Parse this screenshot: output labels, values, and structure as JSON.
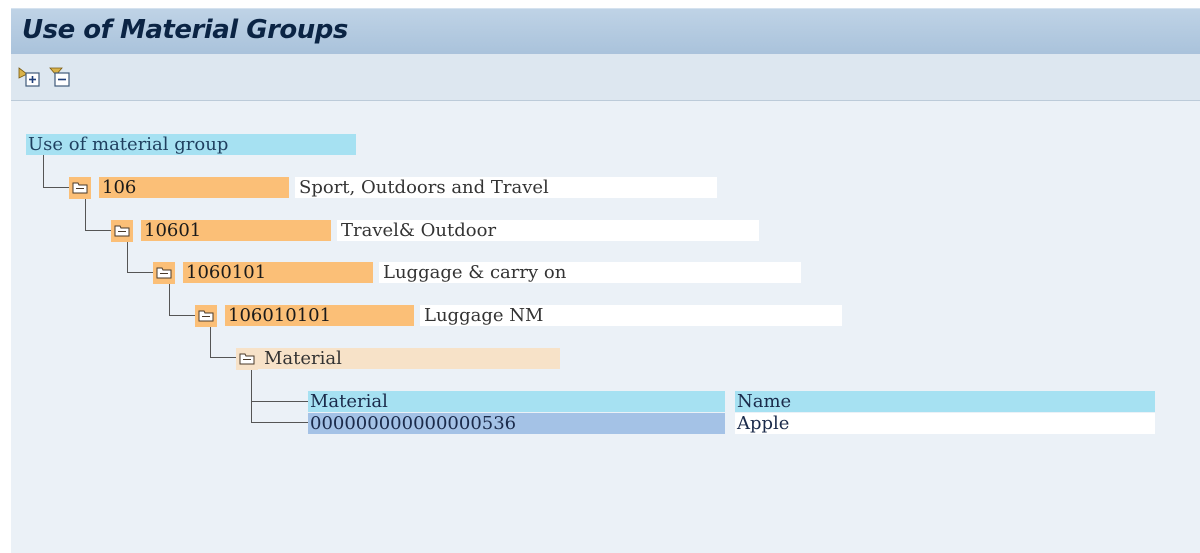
{
  "window": {
    "title": "Use of Material Groups"
  },
  "toolbar": {
    "expand_icon": "expand-subtree-icon",
    "collapse_icon": "collapse-subtree-icon"
  },
  "tree": {
    "root_label": "Use of material group",
    "nodes": [
      {
        "key": "106",
        "text": "Sport, Outdoors and Travel"
      },
      {
        "key": "10601",
        "text": "Travel& Outdoor"
      },
      {
        "key": "1060101",
        "text": "Luggage & carry on"
      },
      {
        "key": "106010101",
        "text": "Luggage NM"
      }
    ],
    "material_node": "Material"
  },
  "table": {
    "headers": [
      "Material",
      "Name"
    ],
    "rows": [
      [
        "000000000000000536",
        "Apple"
      ]
    ]
  }
}
